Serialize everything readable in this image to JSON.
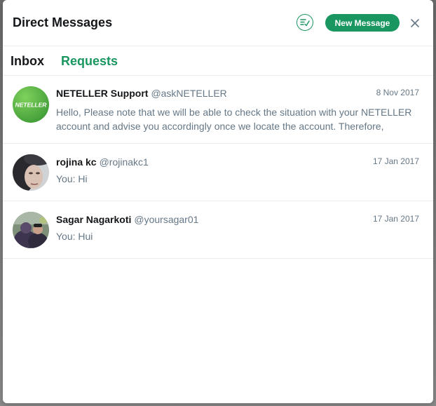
{
  "dialog": {
    "title": "Direct Messages",
    "new_message_label": "New Message",
    "colors": {
      "accent": "#1a9660",
      "muted": "#657786",
      "text": "#14171a"
    }
  },
  "tabs": [
    {
      "label": "Inbox",
      "active": true
    },
    {
      "label": "Requests",
      "active": false
    }
  ],
  "conversations": [
    {
      "name": "NETELLER Support",
      "handle": "@askNETELLER",
      "date": "8 Nov 2017",
      "snippet": "Hello, Please note that we will be able to check the situation with your NETELLER account and advise you accordingly once we locate the account. Therefore,",
      "avatar_text": "NETELLER"
    },
    {
      "name": "rojina kc",
      "handle": "@rojinakc1",
      "date": "17 Jan 2017",
      "snippet": "You: Hi"
    },
    {
      "name": "Sagar Nagarkoti",
      "handle": "@yoursagar01",
      "date": "17 Jan 2017",
      "snippet": "You: Hui"
    }
  ]
}
